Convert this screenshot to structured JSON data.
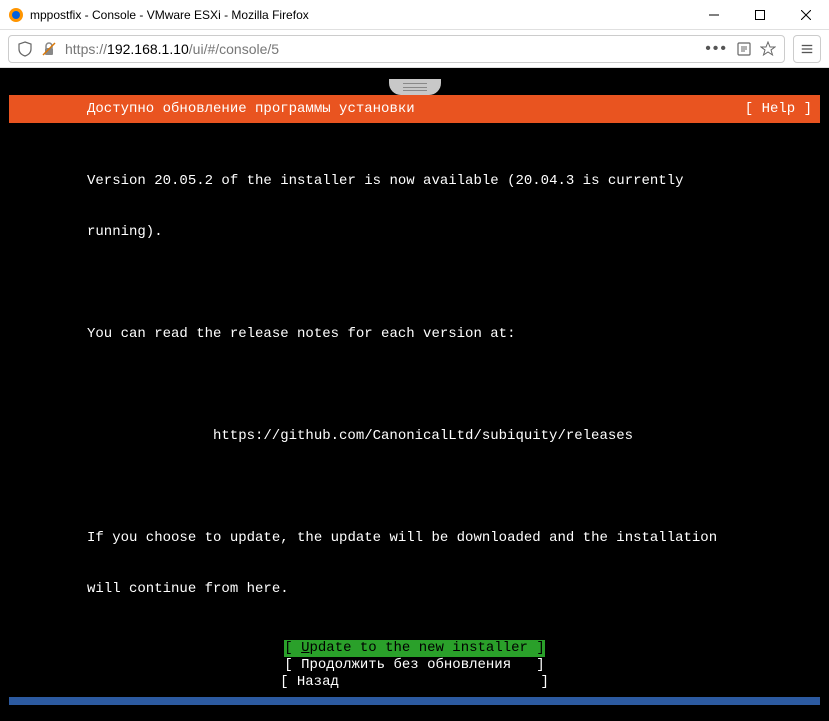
{
  "window": {
    "title": "mppostfix - Console - VMware ESXi - Mozilla Firefox"
  },
  "address": {
    "prefix": "https://",
    "ip": "192.168.1.10",
    "path": "/ui/#/console/5"
  },
  "installer": {
    "header_title": "Доступно обновление программы установки",
    "help_label": "[ Help ]",
    "line1": "Version 20.05.2 of the installer is now available (20.04.3 is currently",
    "line2": "running).",
    "line3": "You can read the release notes for each version at:",
    "release_url": "https://github.com/CanonicalLtd/subiquity/releases",
    "line4": "If you choose to update, the update will be downloaded and the installation",
    "line5": "will continue from here.",
    "actions": {
      "update": "[ Update to the new installer ]",
      "continue": "[ Продолжить без обновления   ]",
      "back": "[ Назад                        ]"
    }
  }
}
